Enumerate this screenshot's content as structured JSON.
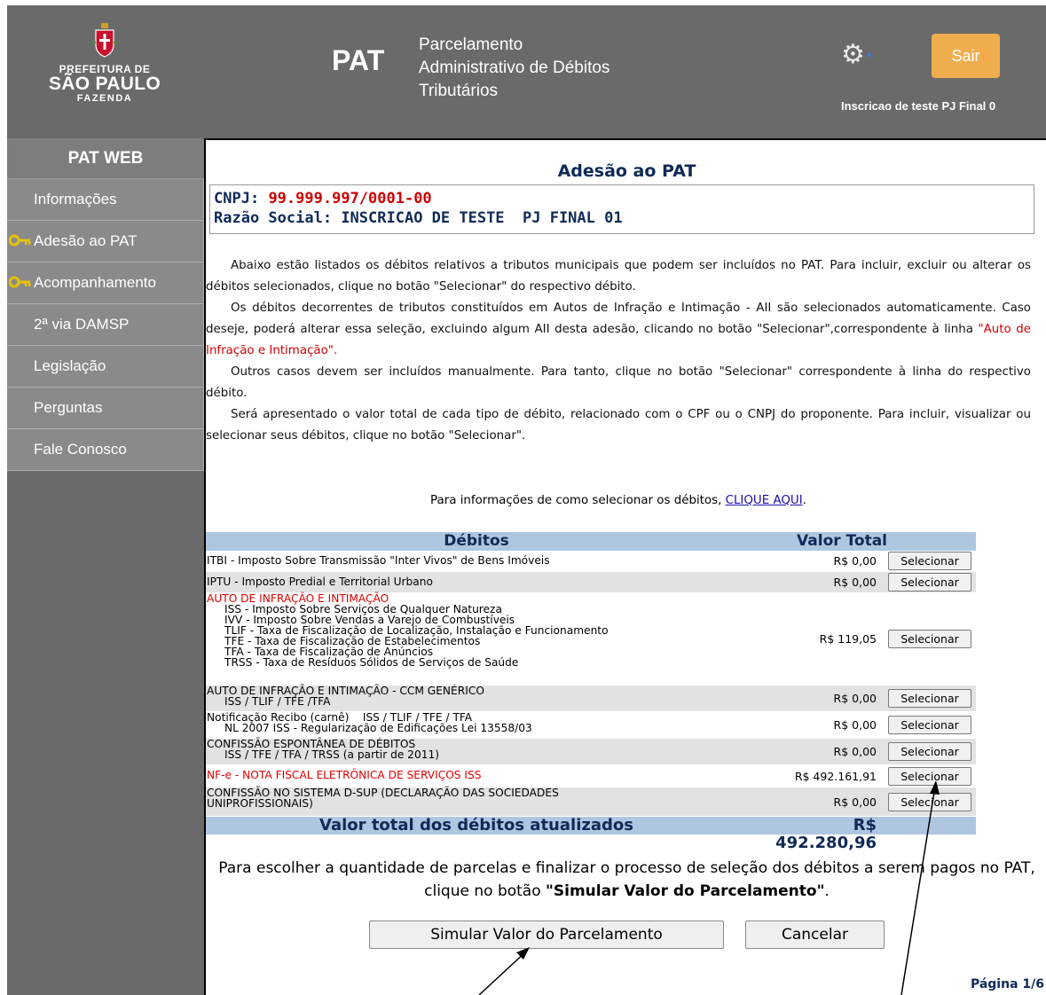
{
  "header": {
    "logo_line1": "PREFEITURA DE",
    "logo_line2": "SÃO PAULO",
    "logo_line3": "FAZENDA",
    "app_short": "PAT",
    "app_full": "Parcelamento Administrativo de Débitos Tributários",
    "logout_label": "Sair",
    "user_name": "Inscricao de teste PJ Final 0",
    "settings_icon": "gear-icon",
    "colors": {
      "header_bg": "#6a6a6a",
      "logout_bg": "#f0ad4e"
    }
  },
  "sidebar": {
    "title": "PAT WEB",
    "items": [
      {
        "label": "Informações",
        "icon": ""
      },
      {
        "label": "Adesão ao PAT",
        "icon": "key-icon"
      },
      {
        "label": "Acompanhamento",
        "icon": "key-icon"
      },
      {
        "label": "2ª via DAMSP",
        "icon": ""
      },
      {
        "label": "Legislação",
        "icon": ""
      },
      {
        "label": "Perguntas",
        "icon": ""
      },
      {
        "label": "Fale Conosco",
        "icon": ""
      }
    ]
  },
  "main": {
    "heading": "Adesão ao PAT",
    "cnpj_label": "CNPJ:",
    "cnpj_value": "99.999.997/0001-00",
    "razao_label": "Razão Social:",
    "razao_value": "INSCRICAO DE TESTE  PJ FINAL 01",
    "intro": {
      "p1": "Abaixo estão listados os débitos relativos a tributos municipais que podem ser incluídos no PAT. Para incluir, excluir ou alterar os débitos selecionados, clique no botão \"Selecionar\" do respectivo débito.",
      "p2_before": "Os débitos decorrentes de tributos constituídos em Autos de Infração e Intimação - AII são selecionados automaticamente. Caso deseje, poderá alterar essa seleção, excluindo algum AII desta adesão, clicando no botão \"Selecionar\",correspondente à linha ",
      "p2_red": "\"Auto de Infração e Intimação\".",
      "p3": "Outros casos devem ser incluídos manualmente. Para tanto, clique no botão \"Selecionar\" correspondente à linha do respectivo débito.",
      "p4": "Será apresentado o valor total de cada tipo de débito, relacionado com o CPF ou o CNPJ do proponente. Para incluir, visualizar ou selecionar seus débitos, clique no botão \"Selecionar\"."
    },
    "help_text": "Para informações de como selecionar os débitos, ",
    "help_link": "CLIQUE AQUI",
    "help_end": ".",
    "table": {
      "col_debts": "Débitos",
      "col_total": "Valor Total",
      "select_label": "Selecionar",
      "rows": [
        {
          "lines": [
            "ITBI - Imposto Sobre Transmissão \"Inter Vivos\" de Bens Imóveis"
          ],
          "value": "R$ 0,00"
        },
        {
          "lines": [
            "IPTU - Imposto Predial e Territorial Urbano"
          ],
          "value": "R$ 0,00"
        },
        {
          "lines": [
            "AUTO DE INFRAÇÃO E INTIMAÇÃO",
            "ISS - Imposto Sobre Serviços de Qualquer Natureza",
            "IVV - Imposto Sobre Vendas a Varejo de Combustíveis",
            "TLIF - Taxa de Fiscalização de Localização, Instalação e Funcionamento",
            "TFE - Taxa de Fiscalização de Estabelecimentos",
            "TFA - Taxa de Fiscalização de Anúncios",
            "TRSS - Taxa de Resíduos Sólidos de Serviços de Saúde"
          ],
          "value": "R$ 119,05"
        },
        {
          "lines": [
            "AUTO DE INFRAÇÃO E INTIMAÇÃO - CCM GENÉRICO",
            "ISS / TLIF / TFE /TFA"
          ],
          "value": "R$ 0,00"
        },
        {
          "lines": [
            "Notificação Recibo (carnê)    ISS / TLIF / TFE / TFA",
            "NL 2007 ISS - Regularização de Edificações Lei 13558/03"
          ],
          "value": "R$ 0,00"
        },
        {
          "lines": [
            "CONFISSÃO ESPONTÂNEA DE DÉBITOS",
            "ISS / TFE / TFA / TRSS (a partir de 2011)"
          ],
          "value": "R$ 0,00"
        },
        {
          "lines": [
            "NF-e - NOTA FISCAL ELETRÔNICA DE SERVIÇOS ISS"
          ],
          "value": "R$ 492.161,91"
        },
        {
          "lines": [
            "CONFISSÃO NO SISTEMA D-SUP (DECLARAÇÃO DAS SOCIEDADES",
            "UNIPROFISSIONAIS)"
          ],
          "value": "R$ 0,00"
        }
      ],
      "total_label": "Valor total dos débitos atualizados",
      "total_value": "R$ 492.280,96"
    },
    "finalize_before": "Para escolher a quantidade de parcelas e finalizar o processo de seleção dos débitos a serem pagos no PAT, clique no botão ",
    "finalize_bold": "\"Simular Valor do Parcelamento\"",
    "finalize_end": ".",
    "simulate_label": "Simular Valor do Parcelamento",
    "cancel_label": "Cancelar",
    "page_indicator": "Página 1/6"
  }
}
